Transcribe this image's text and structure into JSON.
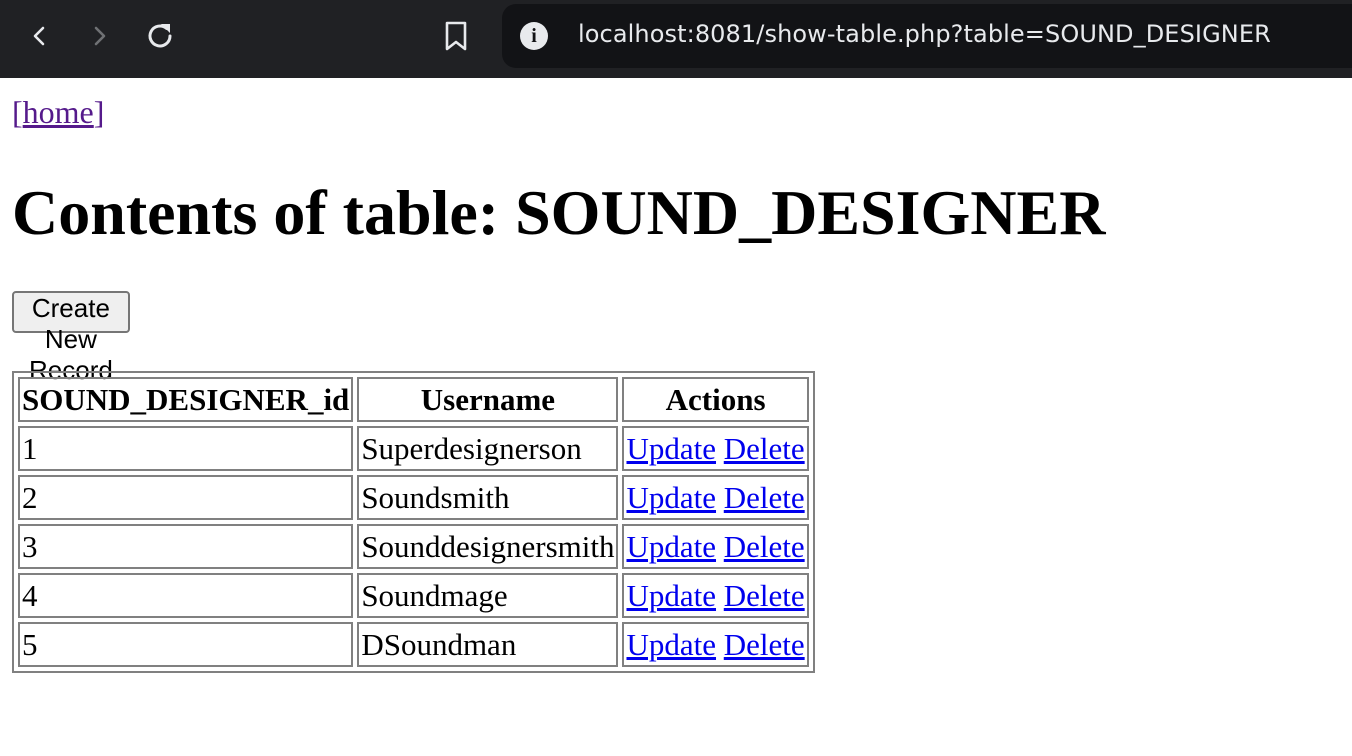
{
  "browser": {
    "url": "localhost:8081/show-table.php?table=SOUND_DESIGNER",
    "icons": {
      "back": "back-icon",
      "forward": "forward-icon",
      "reload": "reload-icon",
      "bookmark": "bookmark-icon",
      "info": "info-icon"
    }
  },
  "page": {
    "home_open": "[",
    "home_link": "home",
    "home_close": "]",
    "title": "Contents of table: SOUND_DESIGNER",
    "create_button": "Create New Record",
    "table": {
      "headers": [
        "SOUND_DESIGNER_id",
        "Username",
        "Actions"
      ],
      "rows": [
        {
          "id": "1",
          "username": "Superdesignerson",
          "update": "Update",
          "delete": "Delete"
        },
        {
          "id": "2",
          "username": "Soundsmith",
          "update": "Update",
          "delete": "Delete"
        },
        {
          "id": "3",
          "username": "Sounddesignersmith",
          "update": "Update",
          "delete": "Delete"
        },
        {
          "id": "4",
          "username": "Soundmage",
          "update": "Update",
          "delete": "Delete"
        },
        {
          "id": "5",
          "username": "DSoundman",
          "update": "Update",
          "delete": "Delete"
        }
      ]
    }
  },
  "colors": {
    "toolbar": "#202124",
    "urlbar": "#121316",
    "visited_link": "#551a8b",
    "link": "#0000ee"
  }
}
